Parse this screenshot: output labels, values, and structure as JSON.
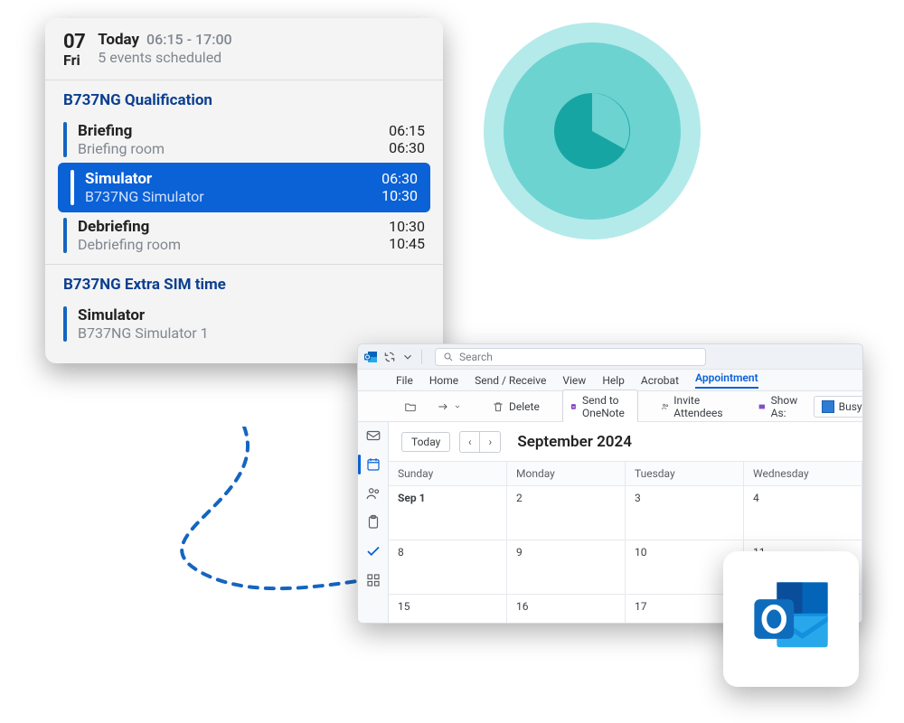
{
  "schedule": {
    "day_number": "07",
    "day_of_week": "Fri",
    "today_label": "Today",
    "time_range": "06:15 - 17:00",
    "subtitle": "5 events scheduled",
    "groups": [
      {
        "title": "B737NG Qualification",
        "events": [
          {
            "name": "Briefing",
            "location": "Briefing room",
            "start": "06:15",
            "end": "06:30",
            "selected": false
          },
          {
            "name": "Simulator",
            "location": "B737NG Simulator",
            "start": "06:30",
            "end": "10:30",
            "selected": true
          },
          {
            "name": "Debriefing",
            "location": "Debriefing room",
            "start": "10:30",
            "end": "10:45",
            "selected": false
          }
        ]
      },
      {
        "title": "B737NG Extra SIM time",
        "events": [
          {
            "name": "Simulator",
            "location": "B737NG Simulator 1",
            "start": "",
            "end": "",
            "selected": false
          }
        ]
      }
    ]
  },
  "outlook": {
    "search_placeholder": "Search",
    "menu": {
      "file": "File",
      "home": "Home",
      "send_receive": "Send / Receive",
      "view": "View",
      "help": "Help",
      "acrobat": "Acrobat",
      "appointment": "Appointment"
    },
    "toolbar": {
      "delete": "Delete",
      "send_onenote": "Send to OneNote",
      "invite": "Invite Attendees",
      "show_as_label": "Show As:",
      "show_as_value": "Busy"
    },
    "calendar": {
      "today_btn": "Today",
      "month_title": "September 2024",
      "dow": [
        "Sunday",
        "Monday",
        "Tuesday",
        "Wednesday"
      ],
      "rows": [
        [
          "Sep 1",
          "2",
          "3",
          "4"
        ],
        [
          "8",
          "9",
          "10",
          "11"
        ],
        [
          "15",
          "16",
          "17",
          ""
        ]
      ]
    }
  }
}
